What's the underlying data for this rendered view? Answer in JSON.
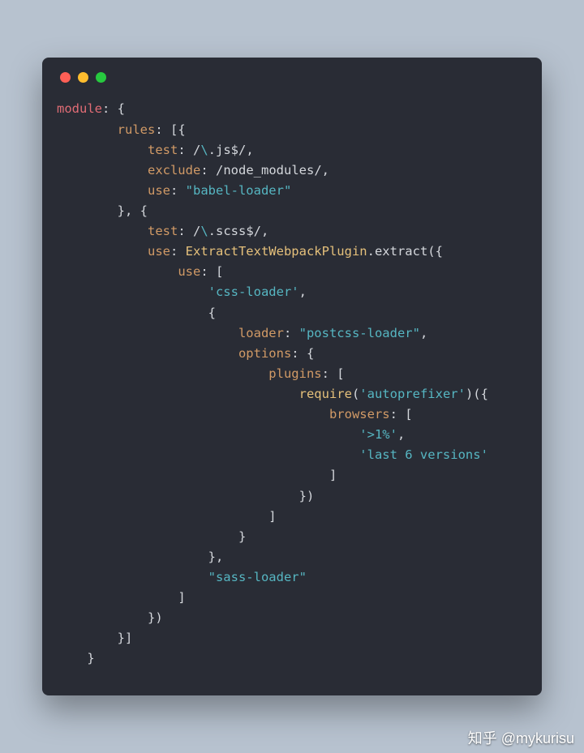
{
  "colors": {
    "background": "#b7c2cf",
    "window": "#292c35",
    "dot_red": "#ff5f56",
    "dot_yellow": "#ffbd2e",
    "dot_green": "#27c93f",
    "syntax_keyword_red": "#e06c75",
    "syntax_property_orange": "#d19a66",
    "syntax_string_teal": "#56b6c2",
    "syntax_identifier_yellow": "#e5c07b",
    "syntax_default": "#d4d7dc"
  },
  "watermark": "知乎 @mykurisu",
  "tokens": {
    "module": "module",
    "rules": "rules",
    "test": "test",
    "exclude": "exclude",
    "use": "use",
    "loader": "loader",
    "options": "options",
    "plugins": "plugins",
    "browsers": "browsers",
    "require_fn": "require",
    "plugin": "ExtractTextWebpackPlugin",
    "extract": "extract",
    "regex_js_a": "/",
    "regex_js_b": "\\",
    "regex_js_c": ".js$",
    "regex_js_d": "/",
    "regex_nm_a": "/",
    "regex_nm_b": "node_modules",
    "regex_nm_c": "/",
    "regex_scss_a": "/",
    "regex_scss_b": "\\",
    "regex_scss_c": ".scss$",
    "regex_scss_d": "/",
    "str_babel": "\"babel-loader\"",
    "str_css": "'css-loader'",
    "str_postcss": "\"postcss-loader\"",
    "str_autoprefixer": "'autoprefixer'",
    "str_gt1": "'>1%'",
    "str_last6": "'last 6 versions'",
    "str_sass": "\"sass-loader\""
  },
  "code_structure": {
    "language": "javascript",
    "context": "webpack.config.js fragment",
    "module": {
      "rules": [
        {
          "test": "/\\.js$/",
          "exclude": "/node_modules/",
          "use": "babel-loader"
        },
        {
          "test": "/\\.scss$/",
          "use": {
            "call": "ExtractTextWebpackPlugin.extract",
            "arg": {
              "use": [
                "css-loader",
                {
                  "loader": "postcss-loader",
                  "options": {
                    "plugins": [
                      {
                        "call": "require('autoprefixer')",
                        "arg": {
                          "browsers": [
                            ">1%",
                            "last 6 versions"
                          ]
                        }
                      }
                    ]
                  }
                },
                "sass-loader"
              ]
            }
          }
        }
      ]
    }
  }
}
